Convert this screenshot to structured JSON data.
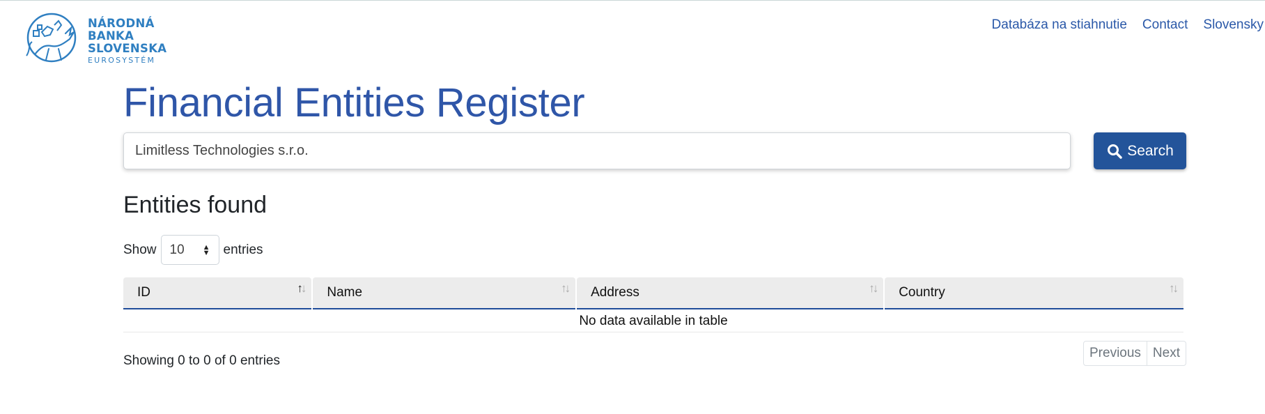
{
  "logo": {
    "line1": "NÁRODNÁ",
    "line2": "BANKA",
    "line3": "SLOVENSKA",
    "line4": "EUROSYSTÉM",
    "color": "#2f7fc1"
  },
  "nav": {
    "items": [
      "Databáza na stiahnutie",
      "Contact",
      "Slovensky"
    ]
  },
  "page": {
    "title": "Financial Entities Register",
    "results_heading": "Entities found"
  },
  "search": {
    "value": "Limitless Technologies s.r.o.",
    "button_label": "Search",
    "button_icon": "search-icon",
    "button_color": "#23549a"
  },
  "length": {
    "show_label": "Show",
    "selected": "10",
    "entries_label": "entries"
  },
  "table": {
    "columns": [
      "ID",
      "Name",
      "Address",
      "Country"
    ],
    "sorted_column": "ID",
    "empty_message": "No data available in table",
    "header_underline_color": "#1f4c99"
  },
  "footer": {
    "info": "Showing 0 to 0 of 0 entries",
    "previous_label": "Previous",
    "next_label": "Next"
  }
}
